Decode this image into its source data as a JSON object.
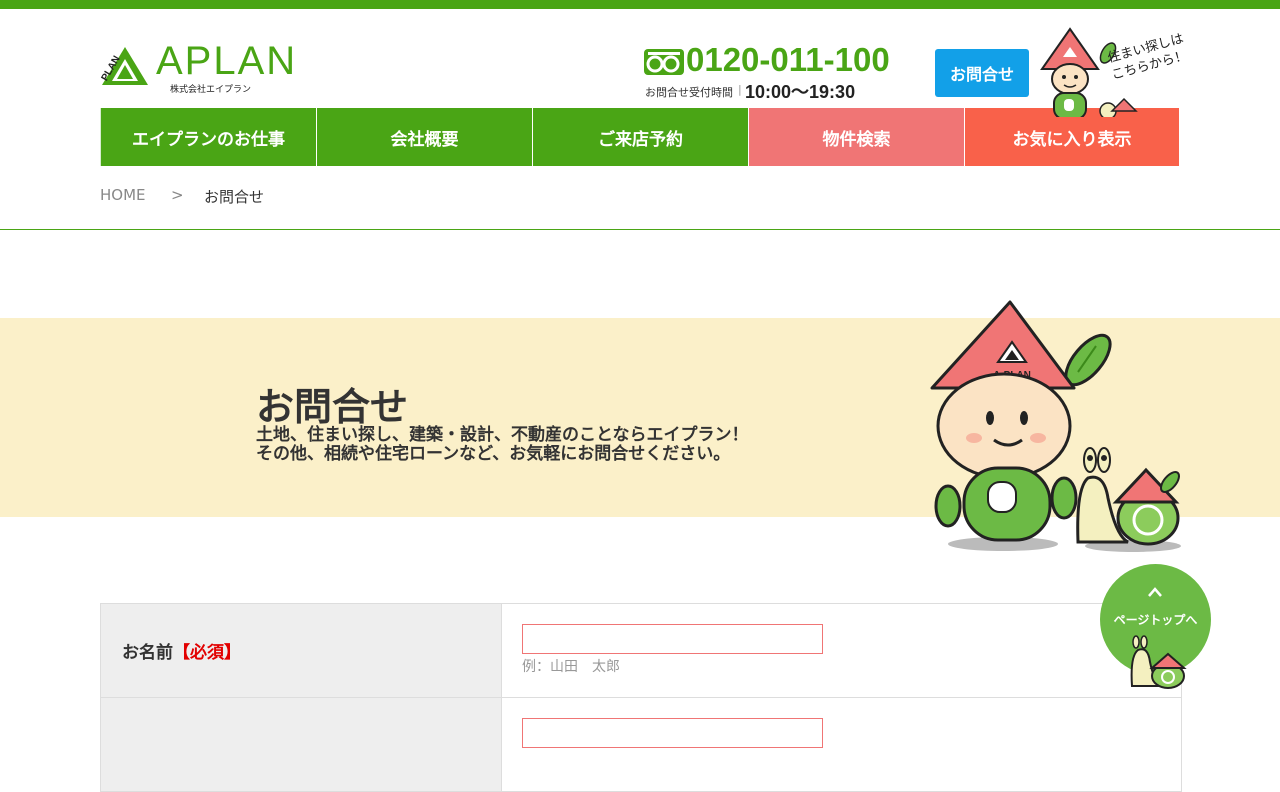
{
  "brand": {
    "logo_text": "APLAN",
    "logo_sub": "株式会社エイプラン",
    "logo_mark_text": "PLAN"
  },
  "header": {
    "phone": "0120-011-100",
    "hours_label": "お問合せ受付時間",
    "hours_separator": "|",
    "hours": "10:00〜19:30",
    "contact_button": "お問合せ",
    "bubble_line1": "住まい探しは",
    "bubble_line2": "こちらから！"
  },
  "nav": {
    "items": [
      {
        "label": "エイプランのお仕事"
      },
      {
        "label": "会社概要"
      },
      {
        "label": "ご来店予約"
      },
      {
        "label": "物件検索"
      },
      {
        "label": "お気に入り表示"
      }
    ]
  },
  "breadcrumb": {
    "home": "HOME",
    "separator": ">",
    "current": "お問合せ"
  },
  "hero": {
    "title": "お問合せ",
    "line1": "土地、住まい探し、建築・設計、不動産のことならエイプラン！",
    "line2": "その他、相続や住宅ローンなど、お気軽にお問合せください。",
    "mascot_label": "A-PLAN"
  },
  "form": {
    "rows": [
      {
        "label": "お名前",
        "required": "【必須】",
        "value": "",
        "example": "例：山田　太郎"
      }
    ]
  },
  "pagetop": {
    "label": "ページトップへ"
  },
  "colors": {
    "brand_green": "#4aa515",
    "accent_pink": "#f07575",
    "accent_orange": "#f9614a",
    "button_blue": "#12a0e8",
    "hero_bg": "#fbf0c9"
  }
}
